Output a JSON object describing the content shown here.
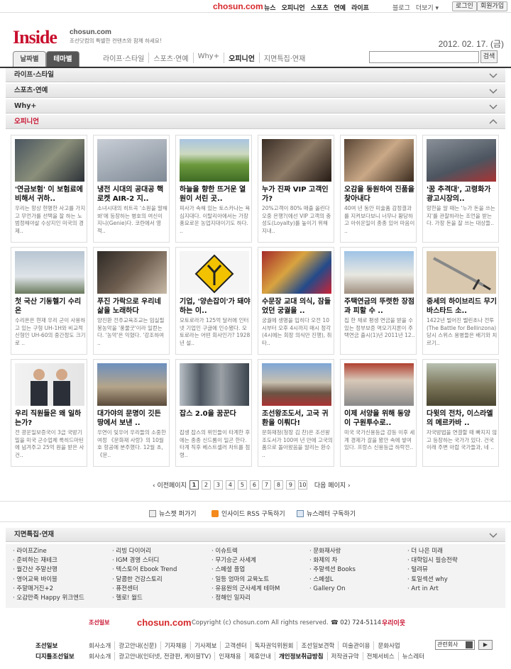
{
  "topbar": {
    "brand": "chosun.com",
    "links": [
      "뉴스",
      "오피니언",
      "스포츠",
      "연예",
      "라이프"
    ],
    "right_links": [
      "블로그",
      "더보기 ▾"
    ],
    "login": "로그인",
    "join": "회원가입"
  },
  "header": {
    "logo": "Inside",
    "site": "chosun.com",
    "tagline": "조선닷컴의 특별한 컨텐츠와 함께 하세요!",
    "date": "2012. 02. 17. (금)"
  },
  "tabs": [
    "날짜별",
    "테마별"
  ],
  "nav": [
    "라이프·스타일",
    "스포츠·연예",
    "Why+",
    "오피니언",
    "지면특집·연재"
  ],
  "search": {
    "button": "검색",
    "placeholder": ""
  },
  "sections": [
    "라이프·스타일",
    "스포츠·연예",
    "Why+",
    "오피니언"
  ],
  "articles": [
    {
      "title": "'연금보험' 이 보험료에 비해서 귀하..",
      "summary": "우리는 항상 현명한 사고를 가지고 무언가를 선택을 잘 하는 노범정해야살 수상지인 미국의 경제.."
    },
    {
      "title": "냉전 시대의 공대공 핵로켓 AIR-2 지..",
      "summary": "소녀시대의 히트곡 '소원을 말해봐'에 등장하는 병호의 여신이 지니(Genie)다. 코란에서 영적.."
    },
    {
      "title": "하늘을 향한 뜨거운 열원이 서린 곳..",
      "summary": "피사가 속해 있는 토스카나는 욕심지대다. 이탈리아에서는 가장 풍요로운 농업지대이기도 하다. .."
    },
    {
      "title": "누가 진짜 VIP 고객인가?",
      "summary": "20%고객이 80% 매출 올린다 오중 은행?(에선 VIP 고객의 충성도(Loyalty)를 높이기 위해 지내.."
    },
    {
      "title": "오감을 동원하여 진품을 찾아내다",
      "summary": "40여 년 동안 미술품 감정결과를 지켜보다보니 너무나 황당하고 아쉬운일이 종종 있어 마음이 .."
    },
    {
      "title": "'꿈 추격대', 고령화가 광고시장의..",
      "summary": "망한을 알 때는 '누가 돈을 쓰는지'를 관찰하라는 조언을 받는다. 가장 돈을 잘 쓰는 대상들.."
    },
    {
      "title": "첫 국산 기동헬기 수리온",
      "summary": "수리온은 현재 우리 군이 사용하고 있는 구형 UH-1H와 비교적 신형인 UH-60의 중간정도 크기로 .."
    },
    {
      "title": "푸진 가락으로 우리네 삶을 노래하다",
      "summary": "양진환 전주교육조교는 임실필봉농악을 '풍물굿'이라 일컫는다. '농악'은 익혔다. '강조하여 .."
    },
    {
      "title": "기업, '양손잡이'가 돼야 하는 이..",
      "summary": "모토로라가 125억 달러에 인터넷 기업인 구글에 인수됐다. 모토로라는 어떤 회사인가? 1928년 설.."
    },
    {
      "title": "수문장 교대 의식, 잠들었던 궁궐을 ..",
      "summary": "궁궐에 생명을 입히다 오전 10시부터 오후 4시까지 매시 정각(4시에는 회장 의식만 진행), 취타.."
    },
    {
      "title": "주택연금의 뚜렷한 장점과 피할 수 ..",
      "summary": "집 한 채로 평생 연금을 받을 수 있는 정부보증 역모기지론이 주택연금 출시(1)년 2011년 12.."
    },
    {
      "title": "중세의 하이브리드 무기 바스타드 소..",
      "summary": "1422년 벌어진 벨린초나 전투(The Battle for Bellinzona)당시 스위스 용병들은 배기와 치르기.."
    },
    {
      "title": "우리 직원들은 왜 일하는가?",
      "summary": "전 광운일보증국이 3급 국방기밀을 미국 군수업체 록히드마틴에 넘겨주고 25억 원을 받은 사건.."
    },
    {
      "title": "대가야의 문명이 깃든 땅에서 보낸 ..",
      "summary": "우연이 잊우어 우리들의 소중한 여정 《문화재 사랑》의 10월호 항공에 분주했다. 12월 초, 《문.."
    },
    {
      "title": "잡스 2.0을 꿈꾼다",
      "summary": "잡생 잡스의 위인들이 타계한 후에는 종종 신드롬이 일곤 한다. 타계 직후 베스트셀러 차트를 점령.."
    },
    {
      "title": "조선왕조도서, 고국 귀환을 이뤄다!",
      "summary": "문화재청(청장 김 찬)은 조선왕조도서가 100여 년 만에 고국의 품으로 돌아왔음을 알리는 환수 .."
    },
    {
      "title": "이제 서양을 위해 동양이 구원투수로..",
      "summary": "미국 국가신용등급 강등 이후 세계 경제가 갈을 봤안 속에 쌓여 있다. 프랑스 신용등급 하락전.."
    },
    {
      "title": "다윗의 전차, 이스라엘의 메르카바 ..",
      "summary": "자국방법을 연결할 때 빠지지 않고 등장하는 국가가 있다. 건국 이래 주변 아랍 국가들과, 네 .."
    }
  ],
  "pager": {
    "prev": "‹ 이전페이지",
    "pages": [
      "1",
      "2",
      "3",
      "4",
      "5",
      "6",
      "7",
      "8",
      "9",
      "10"
    ],
    "next": "다음 페이지 ›"
  },
  "subscribe": [
    "뉴스젯 퍼가기",
    "인사이드 RSS 구독하기",
    "뉴스레터 구독하기"
  ],
  "special": {
    "title": "지면특집·연재",
    "columns": [
      [
        "라이프Zine",
        "준비하는 재테크",
        "월간산 주말산행",
        "영어교육 바이블",
        "주말매거진+2",
        "오감만족 Happy 위크엔드"
      ],
      [
        "리빙 다이어리",
        "IGM 경영 스터디",
        "텍스토어 Ebook Trend",
        "달콤한 건강스토리",
        "퓨전센터",
        "헬로! 월드"
      ],
      [
        "이슈트렉",
        "무기승군 사세계",
        "스페셜 플업",
        "일등 엄마의 교육노트",
        "유용원의 군사세계 테마M",
        "정해인 일자리"
      ],
      [
        "문화재사랑",
        "화제의 차",
        "주말섹션 Books",
        "스페셜L",
        "Gallery On"
      ],
      [
        "더 나은 미래",
        "대학입시 필승전략",
        "털려뮤",
        "토일섹션 why",
        "Art in Art"
      ]
    ]
  },
  "footer": {
    "media_logo": "조선일보",
    "brand": "chosun.com",
    "copyright": "Copyright (c) chosun.com All rights reserved.",
    "tel": "☎ 02) 724-5114",
    "banner": "우리이웃",
    "rows": [
      {
        "name": "조선일보",
        "items": [
          "회사소개",
          "광고안내(신문)",
          "기자채용",
          "기사제보",
          "고객센터",
          "독자권익위원회",
          "조선일보견학",
          "미술관이용",
          "문화사업"
        ]
      },
      {
        "name": "디지틀조선일보",
        "items": [
          "회사소개",
          "광고안내(인터넷, 전광판, 케이블TV)",
          "인재채용",
          "제휴안내",
          "개인정보취급방침",
          "저작권규약",
          "전체서비스",
          "뉴스레터"
        ]
      }
    ],
    "related": "관련회사",
    "go": "▶"
  }
}
